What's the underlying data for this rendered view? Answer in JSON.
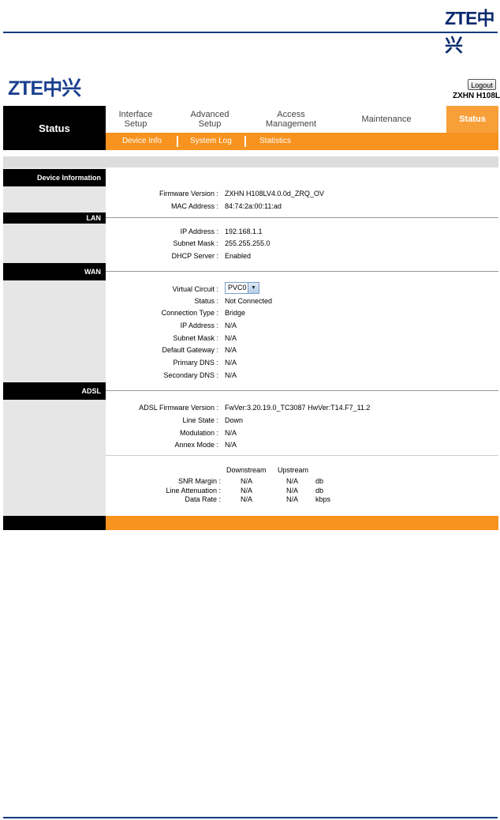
{
  "doc_logo": "ZTE中兴",
  "router": {
    "logo": "ZTE中兴",
    "logout_label": "Logout",
    "model": "ZXHN H108L"
  },
  "nav": {
    "current_section": "Status",
    "tabs": [
      {
        "label_line1": "Interface",
        "label_line2": "Setup"
      },
      {
        "label_line1": "Advanced",
        "label_line2": "Setup"
      },
      {
        "label_line1": "Access",
        "label_line2": "Management"
      },
      {
        "label_line1": "Maintenance",
        "label_line2": ""
      },
      {
        "label_line1": "Status",
        "label_line2": ""
      }
    ],
    "subtabs": [
      "Device Info",
      "System Log",
      "Statistics"
    ]
  },
  "device_info": {
    "heading": "Device Information",
    "rows": [
      {
        "label": "Firmware Version :",
        "value": "ZXHN H108LV4.0.0d_ZRQ_OV"
      },
      {
        "label": "MAC Address :",
        "value": "84:74:2a:00:11:ad"
      }
    ]
  },
  "lan": {
    "heading": "LAN",
    "rows": [
      {
        "label": "IP Address :",
        "value": "192.168.1.1"
      },
      {
        "label": "Subnet Mask :",
        "value": "255.255.255.0"
      },
      {
        "label": "DHCP Server :",
        "value": "Enabled"
      }
    ]
  },
  "wan": {
    "heading": "WAN",
    "virtual_circuit_label": "Virtual Circuit :",
    "virtual_circuit_value": "PVC0",
    "rows": [
      {
        "label": "Status :",
        "value": "Not Connected"
      },
      {
        "label": "Connection Type :",
        "value": "Bridge"
      },
      {
        "label": "IP Address :",
        "value": "N/A"
      },
      {
        "label": "Subnet Mask :",
        "value": "N/A"
      },
      {
        "label": "Default Gateway :",
        "value": "N/A"
      },
      {
        "label": "Primary DNS :",
        "value": "N/A"
      },
      {
        "label": "Secondary DNS :",
        "value": "N/A"
      }
    ]
  },
  "adsl": {
    "heading": "ADSL",
    "rows": [
      {
        "label": "ADSL Firmware Version :",
        "value": "FwVer:3.20.19.0_TC3087 HwVer:T14.F7_11.2"
      },
      {
        "label": "Line State :",
        "value": "Down"
      },
      {
        "label": "Modulation :",
        "value": "N/A"
      },
      {
        "label": "Annex Mode :",
        "value": "N/A"
      }
    ],
    "table": {
      "headers": [
        "Downstream",
        "Upstream"
      ],
      "rows": [
        {
          "label": "SNR Margin :",
          "down": "N/A",
          "up": "N/A",
          "unit": "db"
        },
        {
          "label": "Line Attenuation :",
          "down": "N/A",
          "up": "N/A",
          "unit": "db"
        },
        {
          "label": "Data Rate :",
          "down": "N/A",
          "up": "N/A",
          "unit": "kbps"
        }
      ]
    }
  },
  "colors": {
    "orange": "#f7931e",
    "active_tab": "#f7a03a",
    "brand_blue": "#1a3f8f"
  }
}
